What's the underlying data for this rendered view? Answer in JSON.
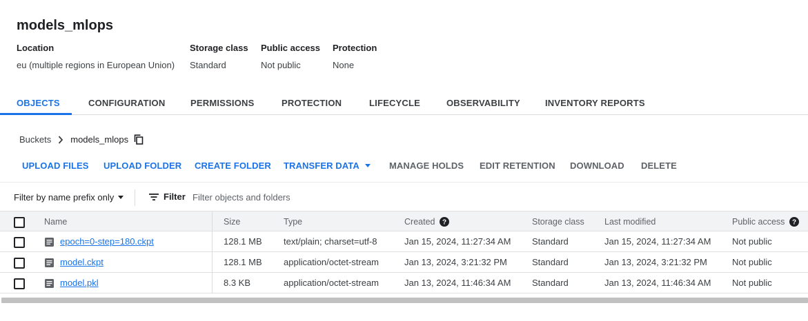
{
  "bucket": {
    "title": "models_mlops",
    "meta": [
      {
        "label": "Location",
        "value": "eu (multiple regions in European Union)"
      },
      {
        "label": "Storage class",
        "value": "Standard"
      },
      {
        "label": "Public access",
        "value": "Not public"
      },
      {
        "label": "Protection",
        "value": "None"
      }
    ]
  },
  "tabs": [
    {
      "label": "OBJECTS",
      "active": true
    },
    {
      "label": "CONFIGURATION"
    },
    {
      "label": "PERMISSIONS"
    },
    {
      "label": "PROTECTION"
    },
    {
      "label": "LIFECYCLE"
    },
    {
      "label": "OBSERVABILITY"
    },
    {
      "label": "INVENTORY REPORTS"
    }
  ],
  "breadcrumb": {
    "root": "Buckets",
    "current": "models_mlops"
  },
  "actions": {
    "upload_files": "UPLOAD FILES",
    "upload_folder": "UPLOAD FOLDER",
    "create_folder": "CREATE FOLDER",
    "transfer_data": "TRANSFER DATA",
    "manage_holds": "MANAGE HOLDS",
    "edit_retention": "EDIT RETENTION",
    "download": "DOWNLOAD",
    "delete": "DELETE"
  },
  "filter": {
    "mode_label": "Filter by name prefix only",
    "filter_label": "Filter",
    "placeholder": "Filter objects and folders"
  },
  "table": {
    "headers": {
      "name": "Name",
      "size": "Size",
      "type": "Type",
      "created": "Created",
      "storage_class": "Storage class",
      "last_modified": "Last modified",
      "public_access": "Public access"
    },
    "rows": [
      {
        "name": "epoch=0-step=180.ckpt",
        "size": "128.1 MB",
        "type": "text/plain; charset=utf-8",
        "created": "Jan 15, 2024, 11:27:34 AM",
        "storage_class": "Standard",
        "last_modified": "Jan 15, 2024, 11:27:34 AM",
        "public_access": "Not public"
      },
      {
        "name": "model.ckpt",
        "size": "128.1 MB",
        "type": "application/octet-stream",
        "created": "Jan 13, 2024, 3:21:32 PM",
        "storage_class": "Standard",
        "last_modified": "Jan 13, 2024, 3:21:32 PM",
        "public_access": "Not public"
      },
      {
        "name": "model.pkl",
        "size": "8.3 KB",
        "type": "application/octet-stream",
        "created": "Jan 13, 2024, 11:46:34 AM",
        "storage_class": "Standard",
        "last_modified": "Jan 13, 2024, 11:46:34 AM",
        "public_access": "Not public"
      }
    ]
  },
  "colors": {
    "accent": "#1a73e8",
    "header_bg": "#f1f3f4",
    "text": "#202124"
  }
}
